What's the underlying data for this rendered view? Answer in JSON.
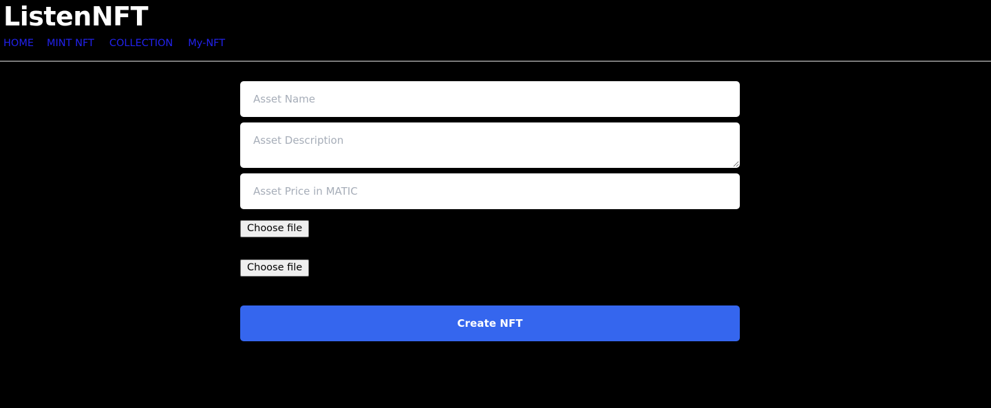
{
  "page": {
    "background_color": "#000000",
    "accent_color": "#3566ee",
    "link_color": "#2222ee",
    "placeholder_color": "#a6adb8"
  },
  "header": {
    "brand": "ListenNFT",
    "nav": [
      {
        "label": "HOME",
        "name": "nav-link-home"
      },
      {
        "label": "MINT NFT",
        "name": "nav-link-mint-nft"
      },
      {
        "label": "COLLECTION",
        "name": "nav-link-collection"
      },
      {
        "label": "My-NFT",
        "name": "nav-link-my-nft"
      }
    ]
  },
  "form": {
    "asset_name": {
      "placeholder": "Asset Name",
      "value": ""
    },
    "asset_description": {
      "placeholder": "Asset Description",
      "value": ""
    },
    "asset_price": {
      "placeholder": "Asset Price in MATIC",
      "value": ""
    },
    "file_primary": {
      "button_label": "Choose file",
      "selected_file": ""
    },
    "file_secondary": {
      "button_label": "Choose file",
      "selected_file": ""
    },
    "submit_label": "Create NFT"
  }
}
